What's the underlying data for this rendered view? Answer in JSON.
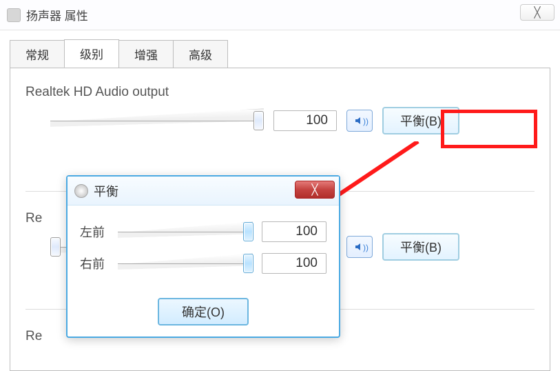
{
  "window": {
    "title": "扬声器 属性",
    "close_glyph": "╳"
  },
  "tabs": {
    "general": "常规",
    "levels": "级别",
    "enhance": "增强",
    "advanced": "高级"
  },
  "device1": {
    "name": "Realtek HD Audio output",
    "value": "100",
    "balance_btn": "平衡(B)"
  },
  "device2": {
    "name": "Re",
    "value": "0",
    "balance_btn": "平衡(B)"
  },
  "device3": {
    "name": "Re"
  },
  "balance_dialog": {
    "title": "平衡",
    "close_glyph": "╳",
    "left_label": "左前",
    "left_value": "100",
    "right_label": "右前",
    "right_value": "100",
    "ok": "确定(O)"
  }
}
